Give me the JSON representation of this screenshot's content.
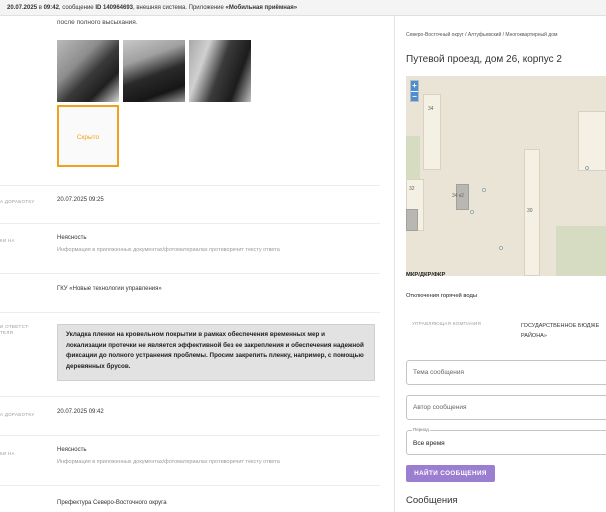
{
  "topbar": {
    "date": "20.07.2025",
    "connector1": " в ",
    "time": "09:42",
    "connector2": ", сообщение ",
    "message_id": "ID 140964693",
    "connector3": ", внешняя система. Приложение ",
    "app_name": "«Мобильная приёмная»"
  },
  "left": {
    "top_text": "после полного высыхания.",
    "hidden_label": "Скрыто",
    "rows": [
      {
        "label": "А ДОРАБОТКУ",
        "value": "20.07.2025 09:25",
        "sub": ""
      },
      {
        "label": "КИ НА",
        "value": "Неясность",
        "sub": "Информация в приложенных документах/фотоматериалах противоречит тексту ответа"
      },
      {
        "label": "",
        "value": "ГКУ «Новые технологии управления»",
        "sub": ""
      },
      {
        "label": "И ОТВЕТСТ-\nТЕЛЯ",
        "value": "",
        "sub": ""
      },
      {
        "label": "А ДОРАБОТКУ",
        "value": "20.07.2025 09:42",
        "sub": ""
      },
      {
        "label": "КИ НА",
        "value": "Неясность",
        "sub": "Информация в приложенных документах/фотоматериалах противоречит тексту ответа"
      },
      {
        "label": "",
        "value": "Префектура Северо-Восточного округа",
        "sub": ""
      }
    ],
    "quote": "Укладка пленки на кровельном покрытии в рамках обеспечения временных мер и локализации протечки не является эффективной без ее закрепления и обеспечения надежной фиксации до полного устранения проблемы. Просим закрепить пленку, например, с помощью деревянных брусов."
  },
  "right": {
    "breadcrumb": "Северо-Восточный округ / Алтуфьевский / Многоквартирный дом",
    "address": "Путевой проезд, дом 26, корпус 2",
    "map": {
      "zoom_in": "+",
      "zoom_out": "−",
      "labels": [
        "34",
        "32",
        "34 к2",
        "30"
      ]
    },
    "section1": "МКР/ДКР/ФКР",
    "section2": "Отключения горячей воды",
    "mgmt_label": "УПРАВЛЯЮЩАЯ КОМПАНИЯ",
    "mgmt_value": "ГОСУДАРСТВЕННОЕ БЮДЖЕ РАЙОНА»",
    "topic_placeholder": "Тема сообщения",
    "author_placeholder": "Автор сообщения",
    "period_legend": "Период",
    "period_value": "Все время",
    "find_button": "НАЙТИ СООБЩЕНИЯ",
    "messages_title": "Сообщения"
  },
  "colors": {
    "accent": "#9c7ed1",
    "hidden_tile": "#f2a11c",
    "map_bg": "#e9e4d6",
    "zoom": "#4a8fd4"
  }
}
